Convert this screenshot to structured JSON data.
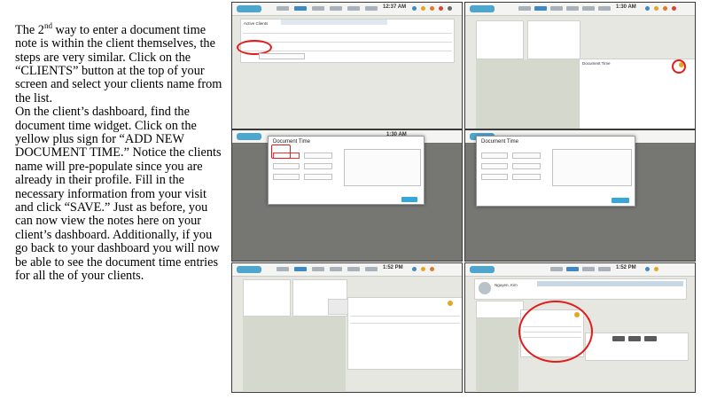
{
  "instructions": {
    "line1_before_sup": "The 2",
    "line1_sup": "nd",
    "line1_after_sup": " way to enter a document time note is within the client themselves, the steps are very similar. Click on  the “CLIENTS” button at the top of your screen and select your clients name from the list.",
    "para2": "On the client’s dashboard, find the document time widget. Click on the yellow plus sign for “ADD NEW DOCUMENT TIME.” Notice the clients name will pre-populate since you are already in their profile. Fill in the necessary information from your visit and click “SAVE.” Just as before, you can now view the notes here on your client’s dashboard. Additionally, if you go back to your dashboard you will now be able to see the document time entries for all the of your clients."
  },
  "screenshots": {
    "one": {
      "panel_title": "Active Clients",
      "clock": "12:37 AM"
    },
    "two": {
      "panel_title": "Document Time",
      "clock": "1:30 AM"
    },
    "three": {
      "modal_title": "Document Time",
      "clock": "1:30 AM"
    },
    "four": {
      "modal_title": "Document Time"
    },
    "five": {
      "clock": "1:52 PM"
    },
    "six": {
      "client_name": "Nguyen, Kim",
      "clock": "1:52 PM"
    }
  },
  "colors": {
    "accent": "#3e89c4",
    "plus_button": "#e7a524",
    "highlight_ring": "#e21c1c",
    "save_button": "#36a7d8"
  }
}
